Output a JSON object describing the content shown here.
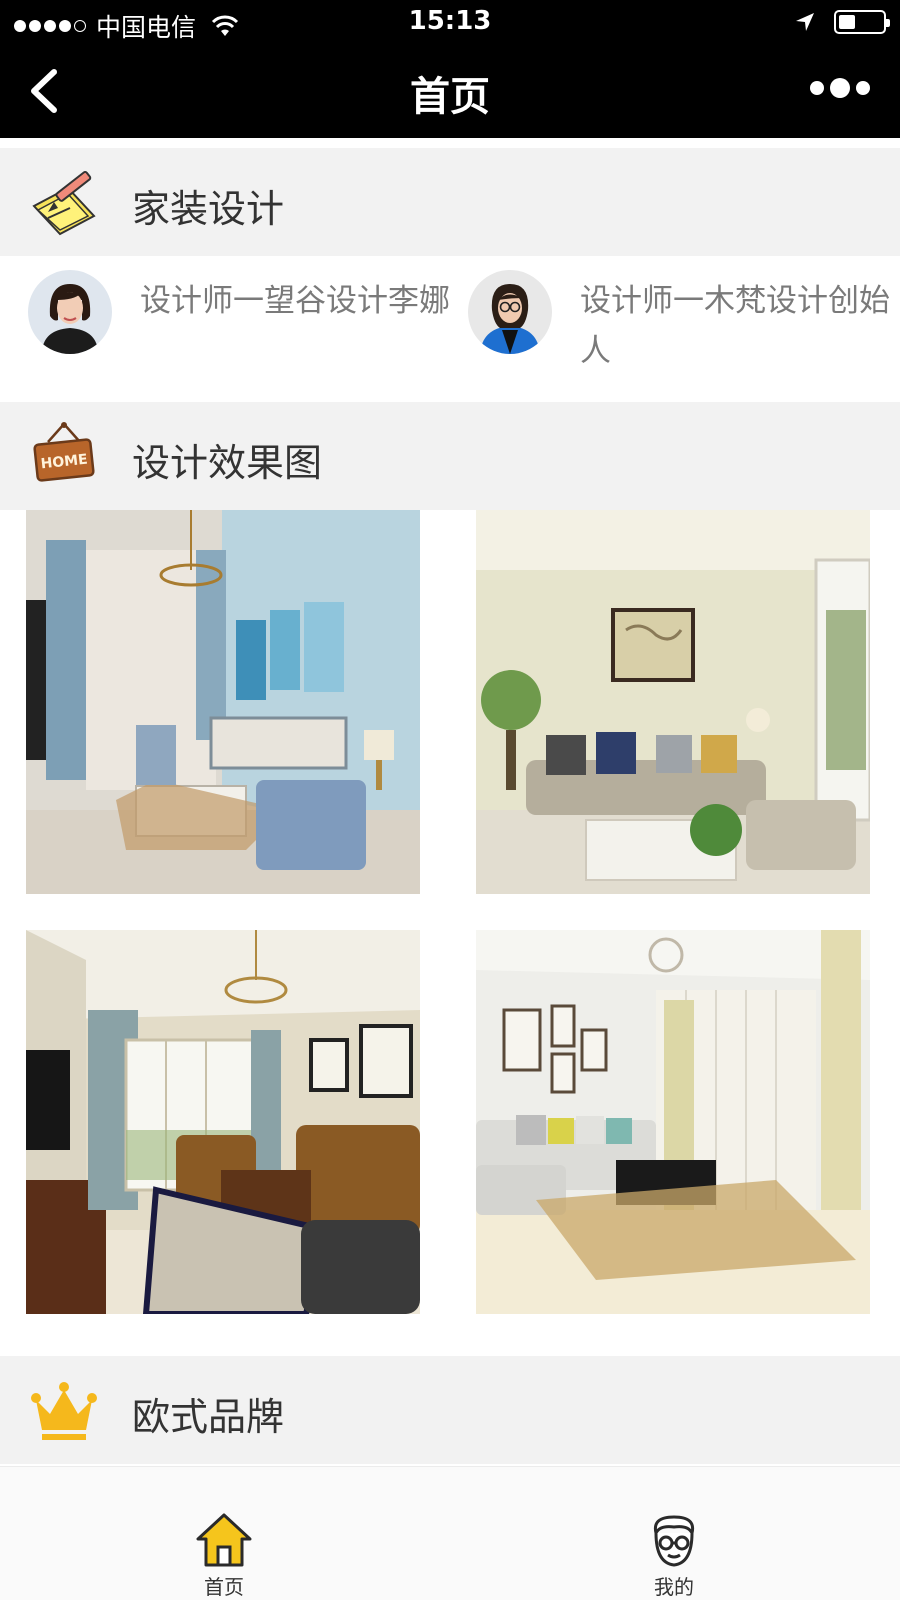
{
  "status_bar": {
    "carrier": "中国电信",
    "time": "15:13"
  },
  "nav": {
    "title": "首页"
  },
  "sections": {
    "home_design": {
      "title": "家装设计",
      "icon": "pencil-note-icon"
    },
    "renderings": {
      "title": "设计效果图",
      "icon": "home-sign-icon"
    },
    "european_brand": {
      "title": "欧式品牌",
      "icon": "crown-icon"
    }
  },
  "designers": [
    {
      "name": "设计师一望谷设计李娜",
      "avatar": "designer-avatar-1"
    },
    {
      "name": "设计师一木梵设计创始人",
      "avatar": "designer-avatar-2"
    }
  ],
  "gallery": [
    {
      "name": "rendering-blue-living-room"
    },
    {
      "name": "rendering-beige-living-room"
    },
    {
      "name": "rendering-classic-living-room"
    },
    {
      "name": "rendering-white-living-room"
    }
  ],
  "tabs": [
    {
      "label": "首页",
      "icon": "home-tab-icon",
      "active": true
    },
    {
      "label": "我的",
      "icon": "profile-tab-icon",
      "active": false
    }
  ],
  "colors": {
    "bar_bg": "#000000",
    "section_bg": "#f2f2f2",
    "accent": "#f5b81c",
    "designer_text": "#7a7a7a"
  }
}
